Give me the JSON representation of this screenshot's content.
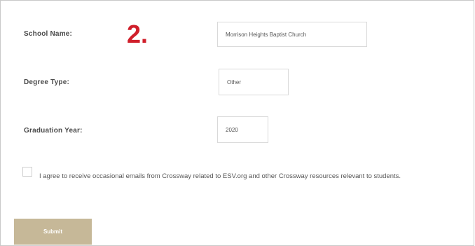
{
  "step_marker": "2.",
  "form": {
    "school_name": {
      "label": "School Name:",
      "value": "Morrison Heights Baptist Church"
    },
    "degree_type": {
      "label": "Degree Type:",
      "value": "Other"
    },
    "graduation_year": {
      "label": "Graduation Year:",
      "value": "2020"
    },
    "consent": {
      "checked": false,
      "text": "I agree to receive occasional emails from Crossway related to ESV.org and other Crossway resources relevant to students."
    },
    "submit_label": "Submit"
  },
  "colors": {
    "submit_bg": "#c6b898",
    "step_marker": "#d01f2b"
  }
}
